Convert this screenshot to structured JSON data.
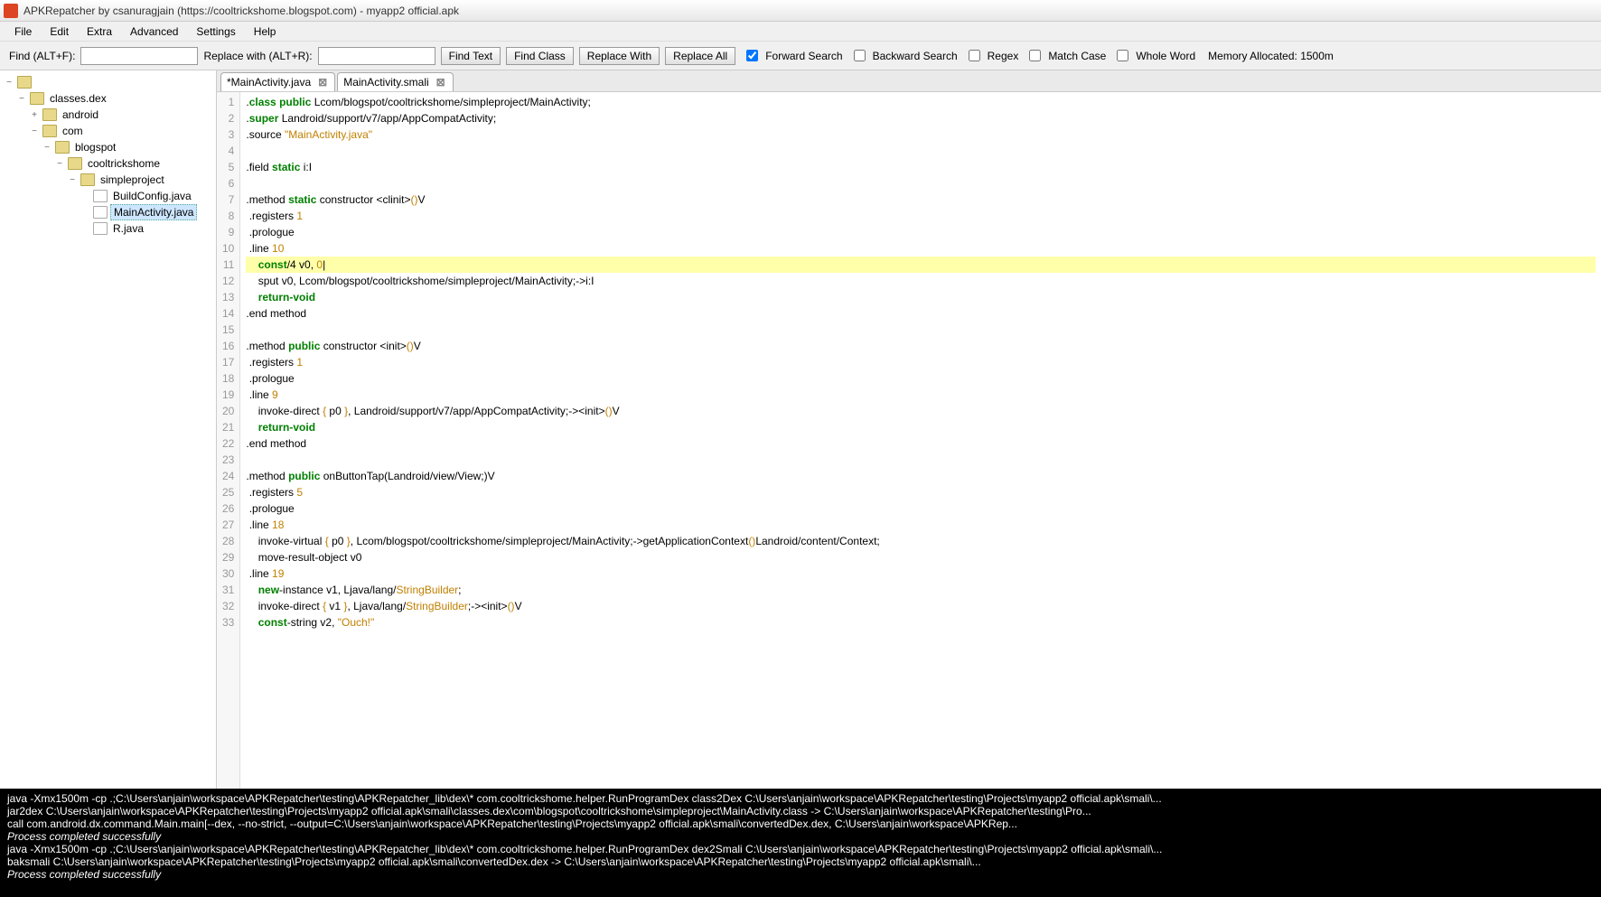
{
  "title": "APKRepatcher by csanuragjain (https://cooltrickshome.blogspot.com) - myapp2 official.apk",
  "menu": [
    "File",
    "Edit",
    "Extra",
    "Advanced",
    "Settings",
    "Help"
  ],
  "toolbar": {
    "find_label": "Find (ALT+F):",
    "replace_label": "Replace with (ALT+R):",
    "find_text": "Find Text",
    "find_class": "Find Class",
    "replace_with": "Replace With",
    "replace_all": "Replace All",
    "forward": "Forward Search",
    "backward": "Backward Search",
    "regex": "Regex",
    "match_case": "Match Case",
    "whole_word": "Whole Word",
    "memory": "Memory Allocated: 1500m"
  },
  "tree": {
    "root": "classes.dex",
    "android": "android",
    "com": "com",
    "blogspot": "blogspot",
    "cooltrickshome": "cooltrickshome",
    "simpleproject": "simpleproject",
    "files": [
      "BuildConfig.java",
      "MainActivity.java",
      "R.java"
    ]
  },
  "tabs": [
    {
      "label": "*MainActivity.java"
    },
    {
      "label": "MainActivity.smali"
    }
  ],
  "code_lines": [
    {
      "n": 1,
      "html": ".<span class='kw-green'>class public</span> Lcom/blogspot/cooltrickshome/simpleproject/MainActivity;"
    },
    {
      "n": 2,
      "html": ".<span class='kw-green'>super</span> Landroid/support/v7/app/AppCompatActivity;"
    },
    {
      "n": 3,
      "html": ".source <span class='kw-string'>\"MainActivity.java\"</span>"
    },
    {
      "n": 4,
      "html": ""
    },
    {
      "n": 5,
      "html": ".field <span class='kw-green'>static</span> i:I"
    },
    {
      "n": 6,
      "html": ""
    },
    {
      "n": 7,
      "html": ".method <span class='kw-green'>static</span> constructor &lt;clinit&gt;<span class='kw-string'>()</span>V"
    },
    {
      "n": 8,
      "html": " .registers <span class='kw-num'>1</span>"
    },
    {
      "n": 9,
      "html": " .prologue"
    },
    {
      "n": 10,
      "html": " .line <span class='kw-num'>10</span>"
    },
    {
      "n": 11,
      "html": "    <span class='kw-green'>const</span>/4 v0, <span class='kw-num'>0</span>|",
      "hl": true
    },
    {
      "n": 12,
      "html": "    sput v0, Lcom/blogspot/cooltrickshome/simpleproject/MainActivity;-&gt;i:I"
    },
    {
      "n": 13,
      "html": "    <span class='kw-green'>return-void</span>"
    },
    {
      "n": 14,
      "html": ".end method"
    },
    {
      "n": 15,
      "html": ""
    },
    {
      "n": 16,
      "html": ".method <span class='kw-green'>public</span> constructor &lt;init&gt;<span class='kw-string'>()</span>V"
    },
    {
      "n": 17,
      "html": " .registers <span class='kw-num'>1</span>"
    },
    {
      "n": 18,
      "html": " .prologue"
    },
    {
      "n": 19,
      "html": " .line <span class='kw-num'>9</span>"
    },
    {
      "n": 20,
      "html": "    invoke-direct <span class='kw-string'>{</span> p0 <span class='kw-string'>}</span>, Landroid/support/v7/app/AppCompatActivity;-&gt;&lt;init&gt;<span class='kw-string'>()</span>V"
    },
    {
      "n": 21,
      "html": "    <span class='kw-green'>return-void</span>"
    },
    {
      "n": 22,
      "html": ".end method"
    },
    {
      "n": 23,
      "html": ""
    },
    {
      "n": 24,
      "html": ".method <span class='kw-green'>public</span> onButtonTap(Landroid/view/View;)V"
    },
    {
      "n": 25,
      "html": " .registers <span class='kw-num'>5</span>"
    },
    {
      "n": 26,
      "html": " .prologue"
    },
    {
      "n": 27,
      "html": " .line <span class='kw-num'>18</span>"
    },
    {
      "n": 28,
      "html": "    invoke-virtual <span class='kw-string'>{</span> p0 <span class='kw-string'>}</span>, Lcom/blogspot/cooltrickshome/simpleproject/MainActivity;-&gt;getApplicationContext<span class='kw-string'>()</span>Landroid/content/Context;"
    },
    {
      "n": 29,
      "html": "    move-result-object v0"
    },
    {
      "n": 30,
      "html": " .line <span class='kw-num'>19</span>"
    },
    {
      "n": 31,
      "html": "    <span class='kw-green'>new</span>-instance v1, Ljava/lang/<span class='kw-string'>StringBuilder</span>;"
    },
    {
      "n": 32,
      "html": "    invoke-direct <span class='kw-string'>{</span> v1 <span class='kw-string'>}</span>, Ljava/lang/<span class='kw-string'>StringBuilder</span>;-&gt;&lt;init&gt;<span class='kw-string'>()</span>V"
    },
    {
      "n": 33,
      "html": "    <span class='kw-green'>const</span>-string v2, <span class='kw-string'>\"Ouch!\"</span>"
    }
  ],
  "console": [
    "java -Xmx1500m -cp .;C:\\Users\\anjain\\workspace\\APKRepatcher\\testing\\APKRepatcher_lib\\dex\\* com.cooltrickshome.helper.RunProgramDex class2Dex C:\\Users\\anjain\\workspace\\APKRepatcher\\testing\\Projects\\myapp2 official.apk\\smali\\...",
    "jar2dex C:\\Users\\anjain\\workspace\\APKRepatcher\\testing\\Projects\\myapp2 official.apk\\smali\\classes.dex\\com\\blogspot\\cooltrickshome\\simpleproject\\MainActivity.class -> C:\\Users\\anjain\\workspace\\APKRepatcher\\testing\\Pro...",
    "call com.android.dx.command.Main.main[--dex, --no-strict, --output=C:\\Users\\anjain\\workspace\\APKRepatcher\\testing\\Projects\\myapp2 official.apk\\smali\\convertedDex.dex, C:\\Users\\anjain\\workspace\\APKRep...",
    "Process completed successfully",
    "java -Xmx1500m -cp .;C:\\Users\\anjain\\workspace\\APKRepatcher\\testing\\APKRepatcher_lib\\dex\\* com.cooltrickshome.helper.RunProgramDex dex2Smali C:\\Users\\anjain\\workspace\\APKRepatcher\\testing\\Projects\\myapp2 official.apk\\smali\\...",
    "baksmali C:\\Users\\anjain\\workspace\\APKRepatcher\\testing\\Projects\\myapp2 official.apk\\smali\\convertedDex.dex -> C:\\Users\\anjain\\workspace\\APKRepatcher\\testing\\Projects\\myapp2 official.apk\\smali\\...",
    "Process completed successfully"
  ]
}
